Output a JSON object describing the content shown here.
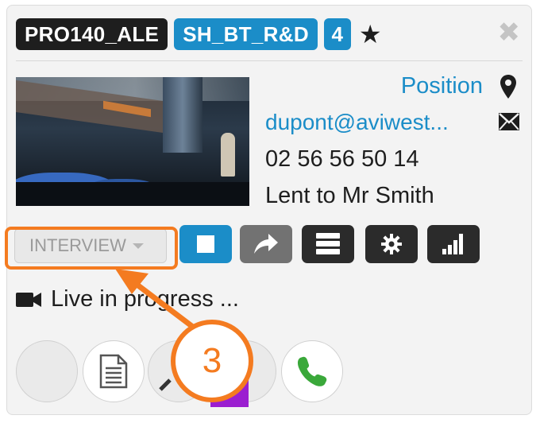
{
  "header": {
    "tags": [
      "PRO140_ALE",
      "SH_BT_R&D",
      "4"
    ],
    "star_icon": "star-icon",
    "close_icon": "close-icon"
  },
  "info": {
    "position_link": "Position",
    "email": "dupont@aviwest...",
    "phone": "02 56 56 50 14",
    "lent_to": "Lent to Mr Smith"
  },
  "controls": {
    "mode_select": "INTERVIEW",
    "buttons": [
      "stop-icon",
      "share-icon",
      "list-icon",
      "gear-icon",
      "signal-icon"
    ]
  },
  "status": {
    "live_text": "Live in progress ..."
  },
  "bottom_actions": [
    "blank",
    "document-icon",
    "wrench-icon",
    "blank",
    "phone-icon"
  ],
  "annotation": {
    "step_number": "3"
  },
  "colors": {
    "brand_blue": "#1b8dc8",
    "annotation_orange": "#f47b20",
    "phone_green": "#3aa83a"
  }
}
